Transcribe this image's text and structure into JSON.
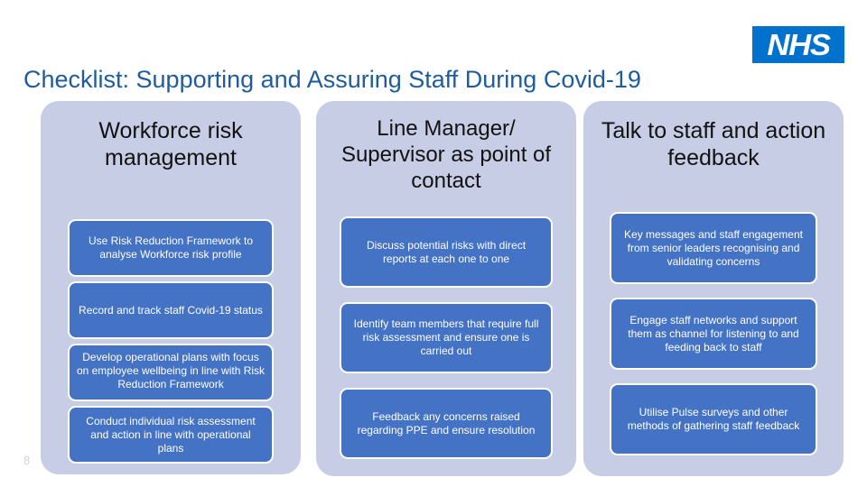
{
  "slide": {
    "title": "Checklist: Supporting and Assuring Staff During Covid-19",
    "number": "8",
    "logo_text": "NHS",
    "colors": {
      "title_blue": "#1F5C9E",
      "panel_lavender": "#C7CDE5",
      "box_blue": "#4472C4",
      "nhs_blue": "#0072CE",
      "box_text": "#FFFFFF",
      "header_text": "#121212",
      "slide_number": "#CFD3E0"
    }
  },
  "columns": [
    {
      "header": "Workforce risk management",
      "items": [
        "Use Risk Reduction Framework to analyse Workforce risk profile",
        "Record and track staff Covid-19 status",
        "Develop operational plans with focus on employee wellbeing in line with Risk Reduction Framework",
        "Conduct individual risk assessment and action in line with operational plans"
      ]
    },
    {
      "header": "Line Manager/ Supervisor as point of contact",
      "items": [
        "Discuss potential risks with direct reports at each one to one",
        "Identify team members that require full risk assessment and ensure one is carried out",
        "Feedback any concerns raised regarding PPE and ensure resolution"
      ]
    },
    {
      "header": "Talk to staff and action feedback",
      "items": [
        "Key messages and staff engagement from senior leaders recognising and validating concerns",
        "Engage staff networks and support them as channel for listening to and feeding back to staff",
        "Utilise Pulse surveys and other methods of gathering staff feedback"
      ]
    }
  ]
}
